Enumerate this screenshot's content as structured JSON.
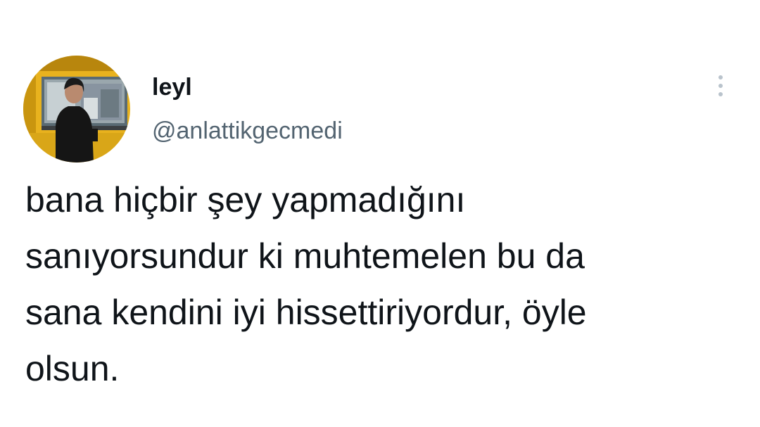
{
  "author": {
    "display_name": "leyl",
    "handle": "@anlattikgecmedi",
    "avatar_icon": "profile-photo"
  },
  "more_icon": "more-vertical-icon",
  "tweet": {
    "lines": [
      "bana hiçbir şey yapmadığını",
      "sanıyorsundur ki muhtemelen bu da",
      "sana kendini iyi hissettiriyordur, öyle",
      "olsun."
    ]
  },
  "colors": {
    "text_primary": "#0f1419",
    "text_secondary": "#536471",
    "icon_muted": "#b9c3cc",
    "background": "#ffffff"
  }
}
